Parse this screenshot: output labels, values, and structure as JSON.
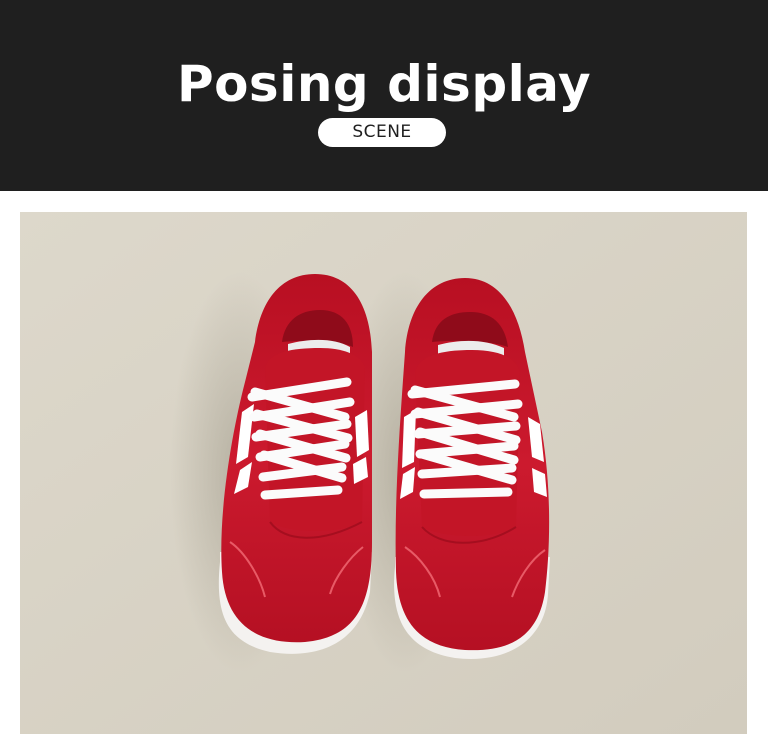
{
  "header": {
    "title": "Posing display",
    "subtitle": "SCENE"
  },
  "photo": {
    "subject": "pair of red sneakers with white laces and white side stripes",
    "colors": {
      "background": "#1f1f1f",
      "backdrop": "#d9d4c7",
      "shoe_red": "#c4142a",
      "sole": "#f4f2f0",
      "laces": "#fbfbfb"
    }
  }
}
